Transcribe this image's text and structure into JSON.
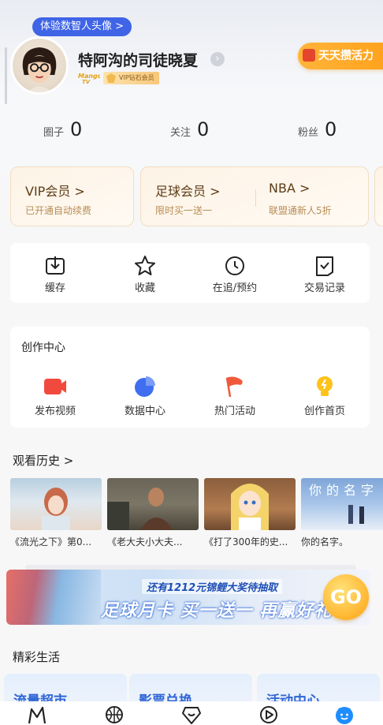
{
  "header": {
    "avatar_tip": "体验数智人头像 >",
    "username": "特阿沟的司徒晓夏",
    "edit_icon": "chevron-right-icon",
    "brand_logo_text": "Mango TV",
    "vip_badge": "VIP钻石会员",
    "energy_button": "天天攒活力"
  },
  "stats": [
    {
      "label": "圈子",
      "value": "0"
    },
    {
      "label": "关注",
      "value": "0"
    },
    {
      "label": "粉丝",
      "value": "0"
    }
  ],
  "membership": [
    {
      "title": "VIP会员 >",
      "subtitle": "已开通自动续费"
    },
    {
      "title": "足球会员 >",
      "subtitle": "限时买一送一"
    },
    {
      "title": "NBA >",
      "subtitle": "联盟通新人5折"
    }
  ],
  "quick_actions": [
    {
      "label": "缓存",
      "icon": "download-icon"
    },
    {
      "label": "收藏",
      "icon": "star-icon"
    },
    {
      "label": "在追/预约",
      "icon": "clock-icon"
    },
    {
      "label": "交易记录",
      "icon": "receipt-icon"
    }
  ],
  "creation_center": {
    "title": "创作中心",
    "items": [
      {
        "label": "发布视频",
        "icon": "video-camera-icon"
      },
      {
        "label": "数据中心",
        "icon": "pie-chart-icon"
      },
      {
        "label": "热门活动",
        "icon": "flag-icon"
      },
      {
        "label": "创作首页",
        "icon": "lightbulb-icon"
      }
    ]
  },
  "history": {
    "title": "观看历史 >",
    "items": [
      {
        "caption": "《流光之下》第0..."
      },
      {
        "caption": "《老大夫小大夫..."
      },
      {
        "caption": "《打了300年的史..."
      },
      {
        "caption": "你的名字。"
      }
    ],
    "poster_text": "你的名字"
  },
  "banner": {
    "top_text": "还有1212元锦鲤大奖待抽取",
    "main_text": "足球月卡 买一送一 再赢好礼",
    "go_label": "GO"
  },
  "life": {
    "title": "精彩生活",
    "cards": [
      {
        "title": "流量超市"
      },
      {
        "title": "影票兑换"
      },
      {
        "title": "活动中心"
      }
    ]
  },
  "tabbar": [
    {
      "icon": "home-logo-icon"
    },
    {
      "icon": "basketball-icon"
    },
    {
      "icon": "heart-badge-icon"
    },
    {
      "icon": "play-circle-icon"
    },
    {
      "icon": "smiley-profile-icon",
      "active": true
    }
  ],
  "colors": {
    "accent_blue": "#3f64e6",
    "energy_orange": "#ffa21c",
    "member_gold": "#5c3c14",
    "active_tab": "#1e8dff"
  }
}
